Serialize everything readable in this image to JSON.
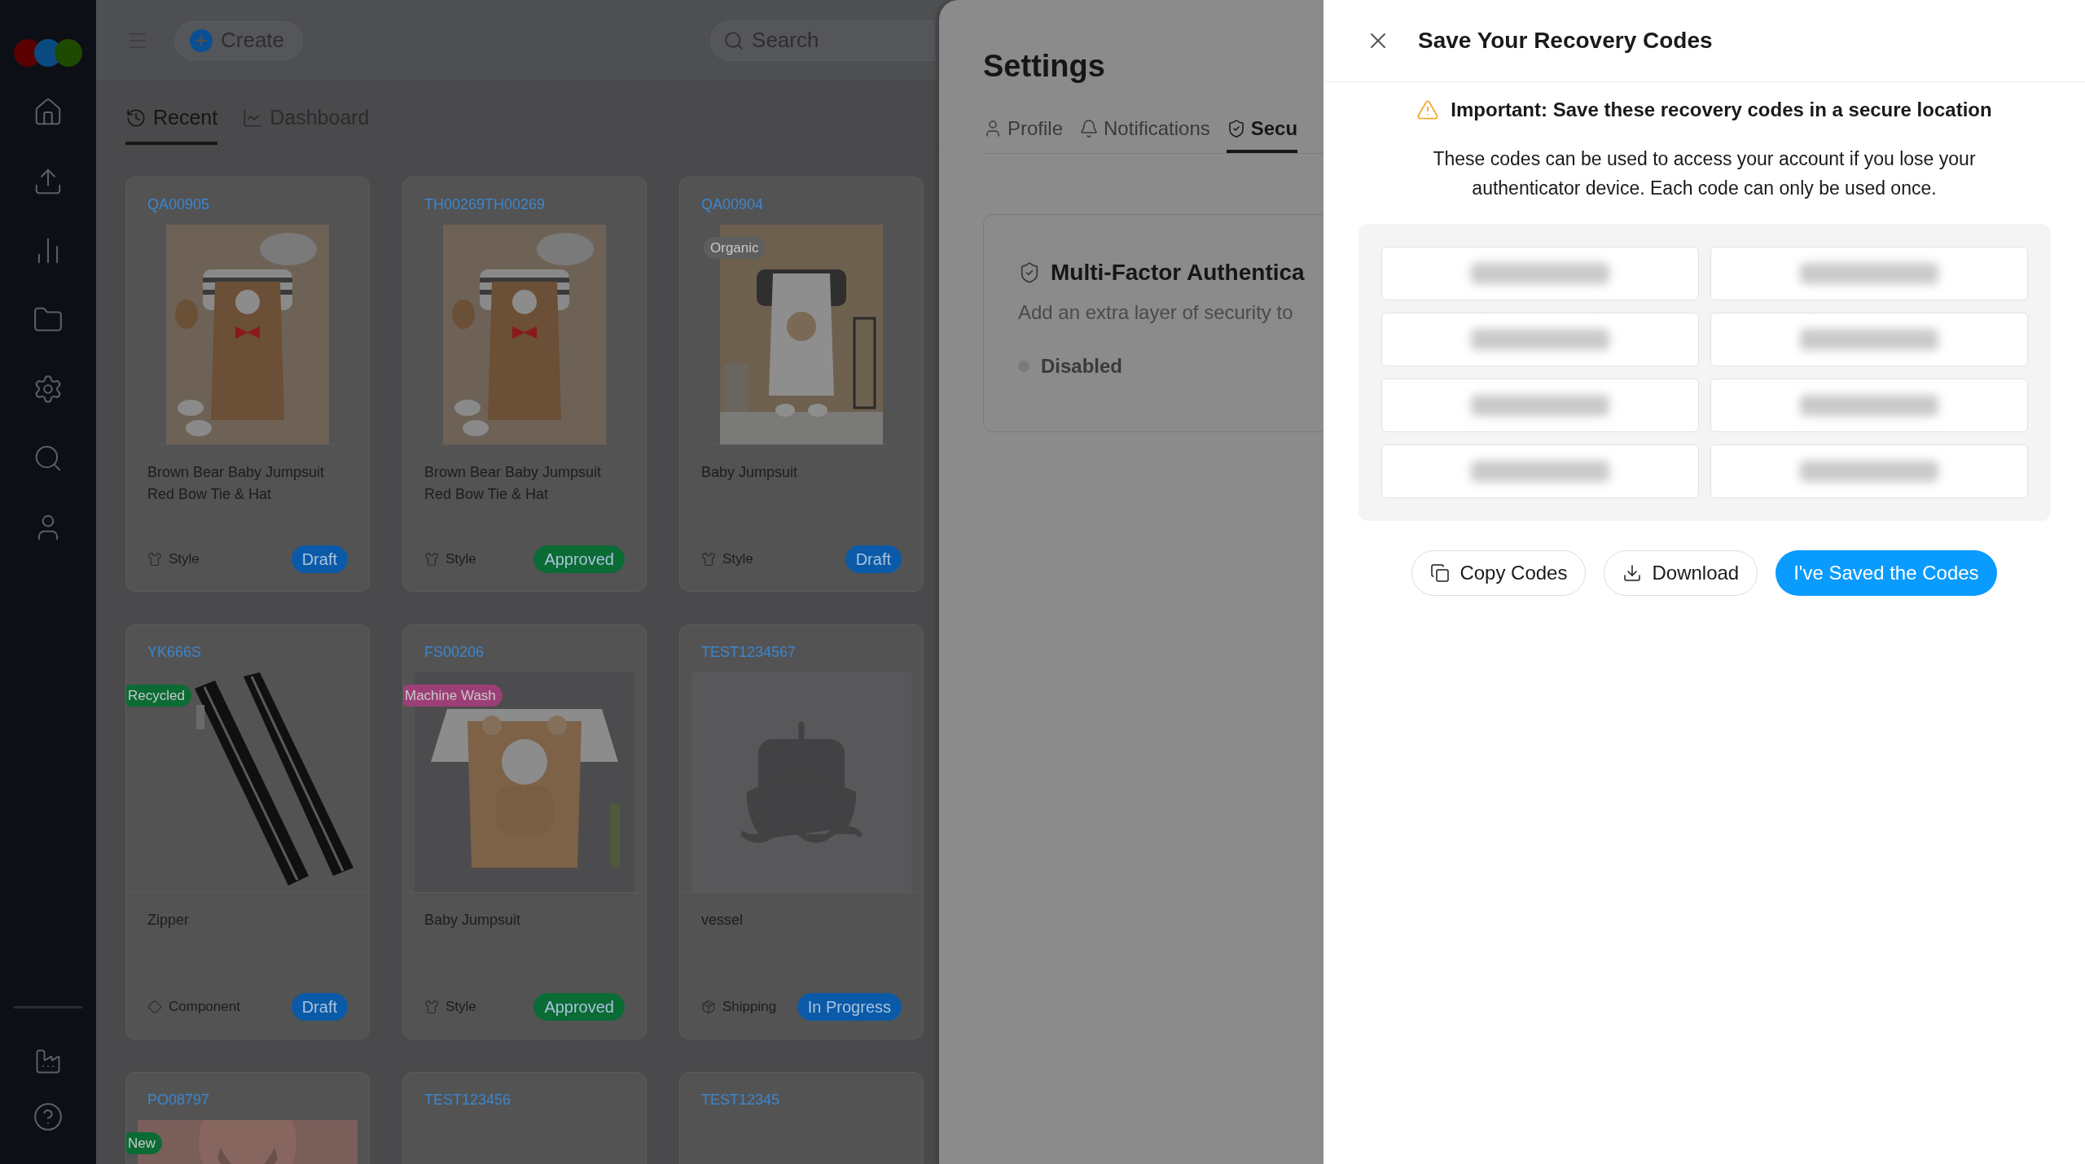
{
  "top_bar": {
    "create_button": "Create",
    "search": {
      "placeholder": "Search"
    }
  },
  "view_tabs": [
    {
      "label": "Recent",
      "selected": true
    },
    {
      "label": "Dashboard",
      "selected": false
    }
  ],
  "cards": [
    {
      "id": "QA00905",
      "name": "Brown Bear Baby Jumpsuit Red Bow Tie & Hat",
      "type": {
        "kind": "style",
        "label": "Style"
      },
      "status": {
        "label": "Draft",
        "color": "#0a5aa8"
      }
    },
    {
      "id": "TH00269TH00269",
      "name": "Brown Bear Baby Jumpsuit Red Bow Tie & Hat",
      "type": {
        "kind": "style",
        "label": "Style"
      },
      "status": {
        "label": "Approved",
        "color": "#0b6b34"
      }
    },
    {
      "id": "QA00904",
      "image": {
        "kind": "picture",
        "tag": {
          "label": "Organic",
          "color": "#5e5e5e"
        }
      },
      "name": "Baby Jumpsuit",
      "type": {
        "kind": "style",
        "label": "Style"
      },
      "status": {
        "label": "Draft",
        "color": "#0a5aa8"
      }
    },
    {
      "id": "YK666S",
      "image": {
        "kind": "picture",
        "tag": {
          "label": "Recycled",
          "color": "#0b6b34"
        }
      },
      "name": "Zipper",
      "type": {
        "kind": "component",
        "label": "Component"
      },
      "status": {
        "label": "Draft",
        "color": "#0a5aa8"
      }
    },
    {
      "id": "FS00206",
      "image": {
        "kind": "picture",
        "tag": {
          "label": "Machine Wash",
          "color": "#9c3f76"
        }
      },
      "name": "Baby Jumpsuit",
      "type": {
        "kind": "style",
        "label": "Style"
      },
      "status": {
        "label": "Approved",
        "color": "#0b6b34"
      }
    },
    {
      "id": "TEST1234567",
      "image": {
        "kind": "placeholder"
      },
      "name": "vessel",
      "type": {
        "kind": "shipping",
        "label": "Shipping"
      },
      "status": {
        "label": "In Progress",
        "color": "#0a5aa8"
      }
    },
    {
      "id": "PO08797",
      "image": {
        "kind": "picture",
        "tag": {
          "label": "New",
          "color": "#0b6b34"
        }
      }
    },
    {
      "id": "TEST123456"
    },
    {
      "id": "TEST12345"
    }
  ],
  "settings": {
    "title": "Settings",
    "tabs": [
      {
        "label": "Profile",
        "selected": false
      },
      {
        "label": "Notifications",
        "selected": false
      },
      {
        "label": "Secu",
        "selected": true
      }
    ],
    "mfa": {
      "title": "Multi-Factor Authentica",
      "description": "Add an extra layer of security to",
      "status": "Disabled",
      "enabled": false
    }
  },
  "recovery_drawer": {
    "title": "Save Your Recovery Codes",
    "warning": "Important: Save these recovery codes in a secure location",
    "description": "These codes can be used to access your account if you lose your authenticator device. Each code can only be used once.",
    "codes": [
      {
        "kind": "blurred"
      },
      {
        "kind": "blurred"
      },
      {
        "kind": "blurred"
      },
      {
        "kind": "blurred"
      },
      {
        "kind": "blurred"
      },
      {
        "kind": "blurred"
      },
      {
        "kind": "blurred"
      },
      {
        "kind": "blurred"
      }
    ],
    "buttons": [
      {
        "label": "Copy Codes",
        "kind": "secondary"
      },
      {
        "label": "Download",
        "kind": "secondary"
      },
      {
        "label": "I've Saved the Codes",
        "kind": "primary"
      }
    ]
  }
}
